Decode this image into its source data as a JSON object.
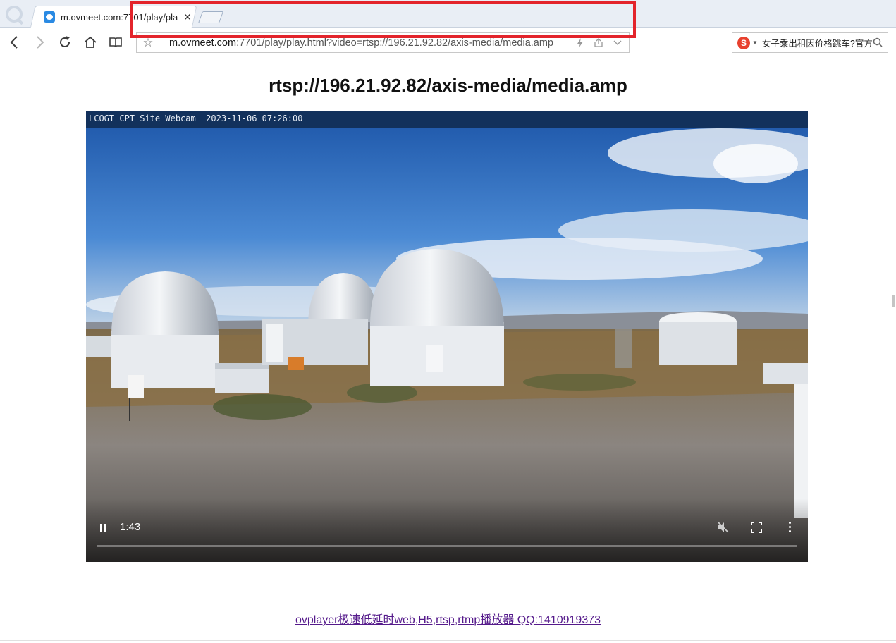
{
  "browser": {
    "tab": {
      "title": "m.ovmeet.com:7701/play/pla",
      "close_symbol": "✕"
    },
    "address_bar": {
      "url_host": "m.ovmeet.com",
      "url_rest": ":7701/play/play.html?video=rtsp://196.21.92.82/axis-media/media.amp"
    },
    "search_box": {
      "engine": "S",
      "text": "女子乘出租因价格跳车?官方"
    },
    "icons": [
      "back-icon",
      "forward-icon",
      "reload-icon",
      "home-icon",
      "reader-icon",
      "star-icon",
      "lightning-icon",
      "share-icon",
      "chevron-down-icon",
      "search-icon"
    ]
  },
  "page": {
    "title": "rtsp://196.21.92.82/axis-media/media.amp",
    "video": {
      "overlay_text": "LCOGT CPT Site Webcam  2023-11-06 07:26:00",
      "current_time": "1:43",
      "muted": true
    },
    "footer_link": "ovplayer极速低延时web,H5,rtsp,rtmp播放器 QQ:1410919373"
  },
  "colors": {
    "highlight_box": "#e3242b",
    "link_visited": "#551a8b",
    "sky": "#2f6fc0"
  }
}
